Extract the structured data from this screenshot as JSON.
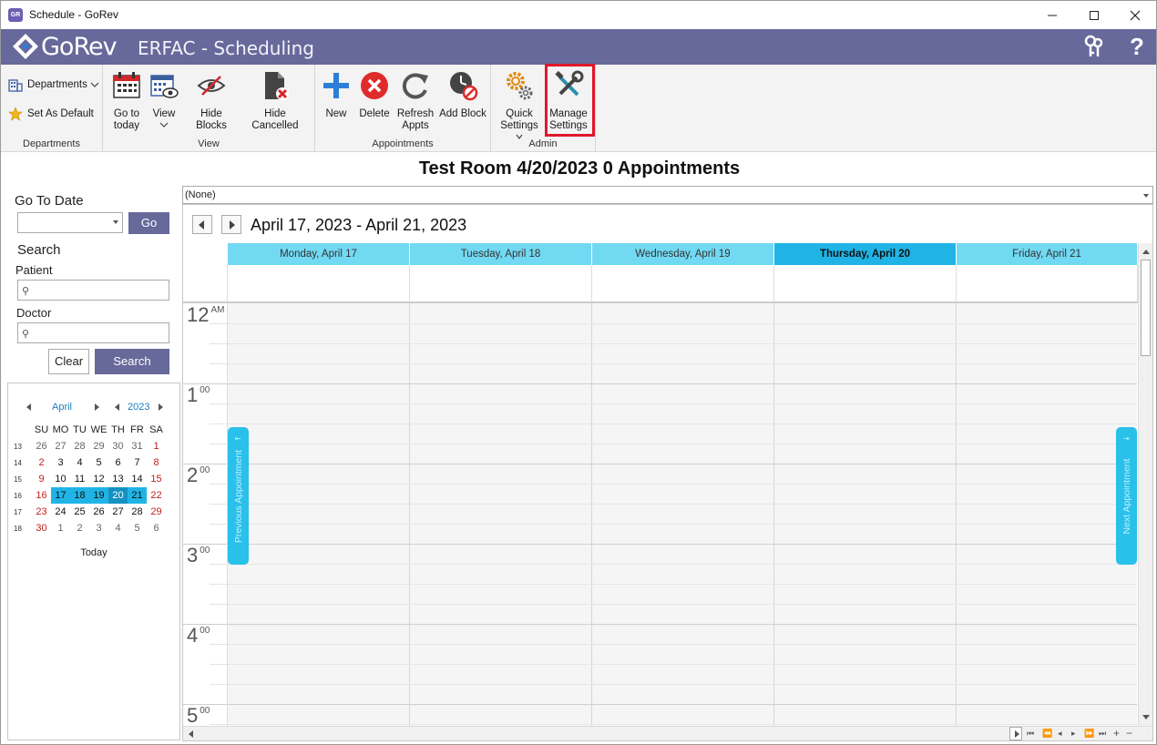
{
  "window": {
    "title": "Schedule - GoRev",
    "app_icon": "GR"
  },
  "header": {
    "logo": "GoRev",
    "title": "ERFAC - Scheduling",
    "colors": {
      "band": "#67699b"
    }
  },
  "ribbon": {
    "groups": {
      "departments": "Departments",
      "view": "View",
      "appointments": "Appointments",
      "admin": "Admin"
    },
    "departments_button": "Departments",
    "set_default": "Set As Default",
    "go_to_today": [
      "Go to",
      "today"
    ],
    "view": "View",
    "hide_blocks": "Hide Blocks",
    "hide_cancelled": "Hide Cancelled",
    "new": "New",
    "delete": "Delete",
    "refresh": [
      "Refresh",
      "Appts"
    ],
    "add_block": "Add Block",
    "quick_settings": [
      "Quick",
      "Settings"
    ],
    "manage_settings": [
      "Manage",
      "Settings"
    ]
  },
  "main_title": "Test Room 4/20/2023 0 Appointments",
  "left_panel": {
    "go_to_date_label": "Go To Date",
    "go_button": "Go",
    "search_label": "Search",
    "patient_label": "Patient",
    "doctor_label": "Doctor",
    "clear_button": "Clear",
    "search_button": "Search",
    "calendar": {
      "month": "April",
      "year": "2023",
      "weekdays": [
        "SU",
        "MO",
        "TU",
        "WE",
        "TH",
        "FR",
        "SA"
      ],
      "weeks": [
        {
          "wk": "13",
          "days": [
            "26",
            "27",
            "28",
            "29",
            "30",
            "31",
            "1"
          ]
        },
        {
          "wk": "14",
          "days": [
            "2",
            "3",
            "4",
            "5",
            "6",
            "7",
            "8"
          ]
        },
        {
          "wk": "15",
          "days": [
            "9",
            "10",
            "11",
            "12",
            "13",
            "14",
            "15"
          ]
        },
        {
          "wk": "16",
          "days": [
            "16",
            "17",
            "18",
            "19",
            "20",
            "21",
            "22"
          ]
        },
        {
          "wk": "17",
          "days": [
            "23",
            "24",
            "25",
            "26",
            "27",
            "28",
            "29"
          ]
        },
        {
          "wk": "18",
          "days": [
            "30",
            "1",
            "2",
            "3",
            "4",
            "5",
            "6"
          ]
        }
      ],
      "today_label": "Today"
    }
  },
  "scheduler": {
    "resource_value": "(None)",
    "range_label": "April 17, 2023 - April 21, 2023",
    "days": [
      {
        "label": "Monday, April 17",
        "current": false
      },
      {
        "label": "Tuesday, April 18",
        "current": false
      },
      {
        "label": "Wednesday, April 19",
        "current": false
      },
      {
        "label": "Thursday, April 20",
        "current": true
      },
      {
        "label": "Friday, April 21",
        "current": false
      }
    ],
    "hours": [
      {
        "h": "12",
        "m": "AM"
      },
      {
        "h": "1",
        "m": "00"
      },
      {
        "h": "2",
        "m": "00"
      },
      {
        "h": "3",
        "m": "00"
      },
      {
        "h": "4",
        "m": "00"
      },
      {
        "h": "5",
        "m": "00"
      }
    ],
    "prev_appointment": "Previous Appointment",
    "next_appointment": "Next Appointment",
    "colors": {
      "day_header": "#72d9f3",
      "current_day": "#20b4e6",
      "nav_tab": "#29c0ea"
    }
  }
}
